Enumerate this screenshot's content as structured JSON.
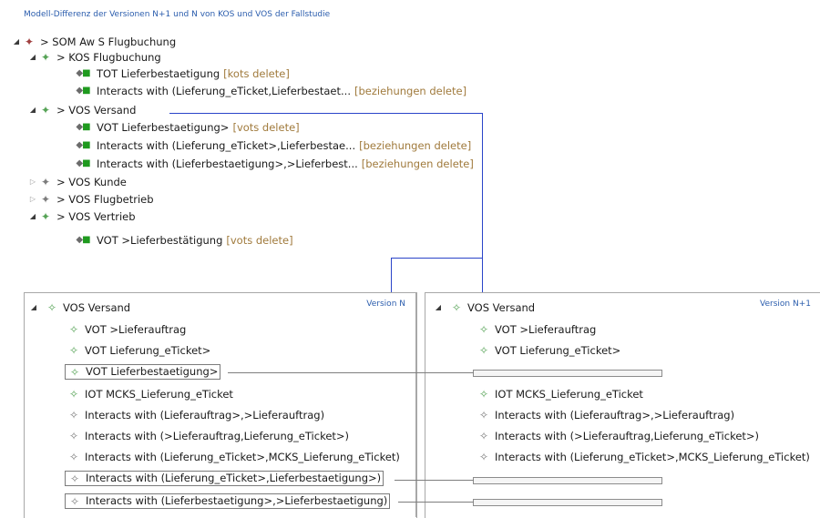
{
  "caption": "Modell-Differenz der Versionen N+1 und N von KOS und VOS der Fallstudie",
  "tree": {
    "root": {
      "label": "> SOM Aw S Flugbuchung"
    },
    "kos": {
      "label": "> KOS Flugbuchung"
    },
    "kos_items": [
      {
        "label": "TOT Lieferbestaetigung",
        "tag": "[kots delete]"
      },
      {
        "label": "Interacts with (Lieferung_eTicket,Lieferbestaet...",
        "tag": "[beziehungen delete]"
      }
    ],
    "vos_versand": {
      "label": "> VOS Versand"
    },
    "vos_versand_items": [
      {
        "label": "VOT Lieferbestaetigung>",
        "tag": "[vots delete]"
      },
      {
        "label": "Interacts with (Lieferung_eTicket>,Lieferbestae...",
        "tag": "[beziehungen delete]"
      },
      {
        "label": "Interacts with (Lieferbestaetigung>,>Lieferbest...",
        "tag": "[beziehungen delete]"
      }
    ],
    "vos_kunde": {
      "label": "> VOS Kunde"
    },
    "vos_flugbetrieb": {
      "label": "> VOS Flugbetrieb"
    },
    "vos_vertrieb": {
      "label": "> VOS Vertrieb"
    },
    "vos_vertrieb_items": [
      {
        "label": "VOT >Lieferbestätigung",
        "tag": "[vots delete]"
      }
    ]
  },
  "panel_n": {
    "version": "Version N",
    "root": "VOS Versand",
    "items": [
      "VOT >Lieferauftrag",
      "VOT Lieferung_eTicket>",
      "VOT Lieferbestaetigung>",
      "IOT MCKS_Lieferung_eTicket",
      "Interacts with (Lieferauftrag>,>Lieferauftrag)",
      "Interacts with (>Lieferauftrag,Lieferung_eTicket>)",
      "Interacts with (Lieferung_eTicket>,MCKS_Lieferung_eTicket)",
      "Interacts with (Lieferung_eTicket>,Lieferbestaetigung>)",
      "Interacts with (Lieferbestaetigung>,>Lieferbestaetigung)"
    ]
  },
  "panel_n1": {
    "version": "Version N+1",
    "root": "VOS Versand",
    "items": [
      "VOT >Lieferauftrag",
      "VOT Lieferung_eTicket>",
      "IOT MCKS_Lieferung_eTicket",
      "Interacts with (Lieferauftrag>,>Lieferauftrag)",
      "Interacts with (>Lieferauftrag,Lieferung_eTicket>)",
      "Interacts with (Lieferung_eTicket>,MCKS_Lieferung_eTicket)"
    ]
  }
}
